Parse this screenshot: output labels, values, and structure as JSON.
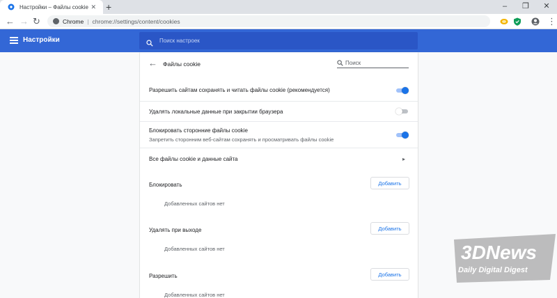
{
  "browser": {
    "tab_title": "Настройки – Файлы cookie",
    "tab_close": "✕",
    "new_tab": "+",
    "window_controls": [
      "–",
      "❐",
      "✕"
    ],
    "nav": {
      "back": "←",
      "forward": "→",
      "reload": "↻"
    },
    "omnibox": {
      "site_label": "Chrome",
      "separator": "|",
      "url": "chrome://settings/content/cookies"
    },
    "menu": "⋮"
  },
  "header": {
    "title": "Настройки",
    "search_placeholder": "Поиск настроек"
  },
  "subpage": {
    "back": "←",
    "title": "Файлы cookie",
    "search_placeholder": "Поиск"
  },
  "settings": [
    {
      "label": "Разрешить сайтам сохранять и читать файлы cookie (рекомендуется)",
      "enabled": true
    },
    {
      "label": "Удалять локальные данные при закрытии браузера",
      "enabled": false
    },
    {
      "label": "Блокировать сторонние файлы cookie",
      "sublabel": "Запретить сторонним веб-сайтам сохранять и просматривать файлы cookie",
      "enabled": true
    }
  ],
  "all_cookies_link": {
    "label": "Все файлы cookie и данные сайта",
    "chevron": "▸"
  },
  "sections": [
    {
      "title": "Блокировать",
      "button": "Добавить",
      "empty": "Добавленных сайтов нет"
    },
    {
      "title": "Удалять при выходе",
      "button": "Добавить",
      "empty": "Добавленных сайтов нет"
    },
    {
      "title": "Разрешить",
      "button": "Добавить",
      "empty": "Добавленных сайтов нет"
    }
  ],
  "watermark": {
    "line1": "3DNews",
    "line2": "Daily Digital Digest"
  },
  "colors": {
    "accent": "#3367d6",
    "toggle_on": "#1a73e8",
    "link": "#1a73e8"
  }
}
